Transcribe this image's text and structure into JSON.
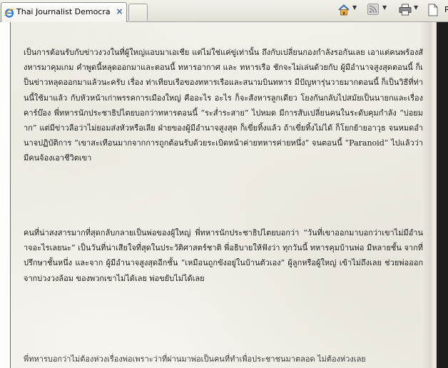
{
  "browser": {
    "tab_title": "Thai Journalist Democrati...",
    "tab_close": "×",
    "command_bar": {
      "items": [
        {
          "icon": "home-icon"
        },
        {
          "icon": "rss-feed-icon"
        },
        {
          "icon": "print-icon"
        },
        {
          "icon": "page-icon",
          "label": "Pa"
        }
      ]
    }
  },
  "article": {
    "paragraphs": [
      "เป็นการต้อนรับกับข่าวงวงในที่ผู้ใหญ่แอบมาเอเชีย แต่ไม่ใช่แค่ขู่เท่านั้น ถึงกับเปลี่ยนกองกำลังรอกันเลย เอาแต่คนพร้องสังหารมาคุมเกม คำพูดนี้หลุดออกมาและตอนนี้ ทหารอากาศ และ ทหารเรือ ชักจะไม่เล่นด้วยกับ ผู้มีอำนาจสูงสุดตอนนี้ ก็เป็นข่าวหลุดออกมาแล้วนะครับ เรื่อง ท่าเทียบเรือของทหารเรือและสนามบินทหาร มีปัญหารุ่นวายมากตอนนี้ ก็เป็นวิธีที่ท่านนี้ใช้มาแล้ว กับหัวหน้าเก่าพรรคการเมืองใหญ่ คืออะไร อะไร ก็จะสังหารลูกเดียว โยงกันกลับไปสมัยเป็นนายกและเรื่องคาร์บ๊อง พี่ทหารนักประชาธิปไตยบอกว่าทหารตอนนี้ “ระส่ำระสาย” ไปหมด มีการสับเปลี่ยนคนในระดับคุมกำลัง “บ่อยมาก” แต่มีข่าวลือว่าไม่ยอมส่งหัวหรือเลีย ฝ่ายของผู้มีอำนาจสูงสุด ก็เขี่ยทิ้งแล้ว ถ้าเขี่ยทิ้งไม่ได้ ก็โยกย้ายอาวุธ จนหมดอำนาจปฏิบัติการ “เขาสะเทือนมากจากการถูกต้อนรับด้วยระเบิดหน้าค่ายทหารค่ายหนึ่ง” จนตอนนี้ “Paranoid” ไปแล้วว่ามีคนจ้องเอาชีวิตเขา",
      "คนที่น่าสงสารมากที่สุดกลับกลายเป็นพ่อของผู้ใหญ่ พี่ทหารนักประชาธิปไตยบอกว่า “วันที่เขาออกมาบอกว่าเขาไม่มีอำนาจอะไรเลยนะ” เป็นวันที่น่าเสียใจที่สุดในประวัติศาสตร์ชาติ พี่อธิบายให้ฟังว่า ทุกวันนี้ ทหารคุมบ้านพ่อ มีหลายชั้น จากที่ปรึกษาชั้นหนึ่ง และจาก ผู้มีอำนาจสูงสุดอีกชั้น “เหมือนถูกขังอยู่ในบ้านตัวเอง” ผู้ลูกหรือผู้ใหญ่ เข้าไม่ถึงเลย ช่วยพ่อออกจากบ่วงวงล้อม ของพวกเขาไม่ได้เลย พ่อขยับไม่ได้เลย",
      "พี่ทหารบอกว่าไม่ต้องห่วงเรื่องพ่อเพราะว่าที่ผ่านมาพ่อเป็นคนที่ทำเพื่อประชาชนมาตลอด ไม่ต้องห่วงเลย"
    ]
  }
}
